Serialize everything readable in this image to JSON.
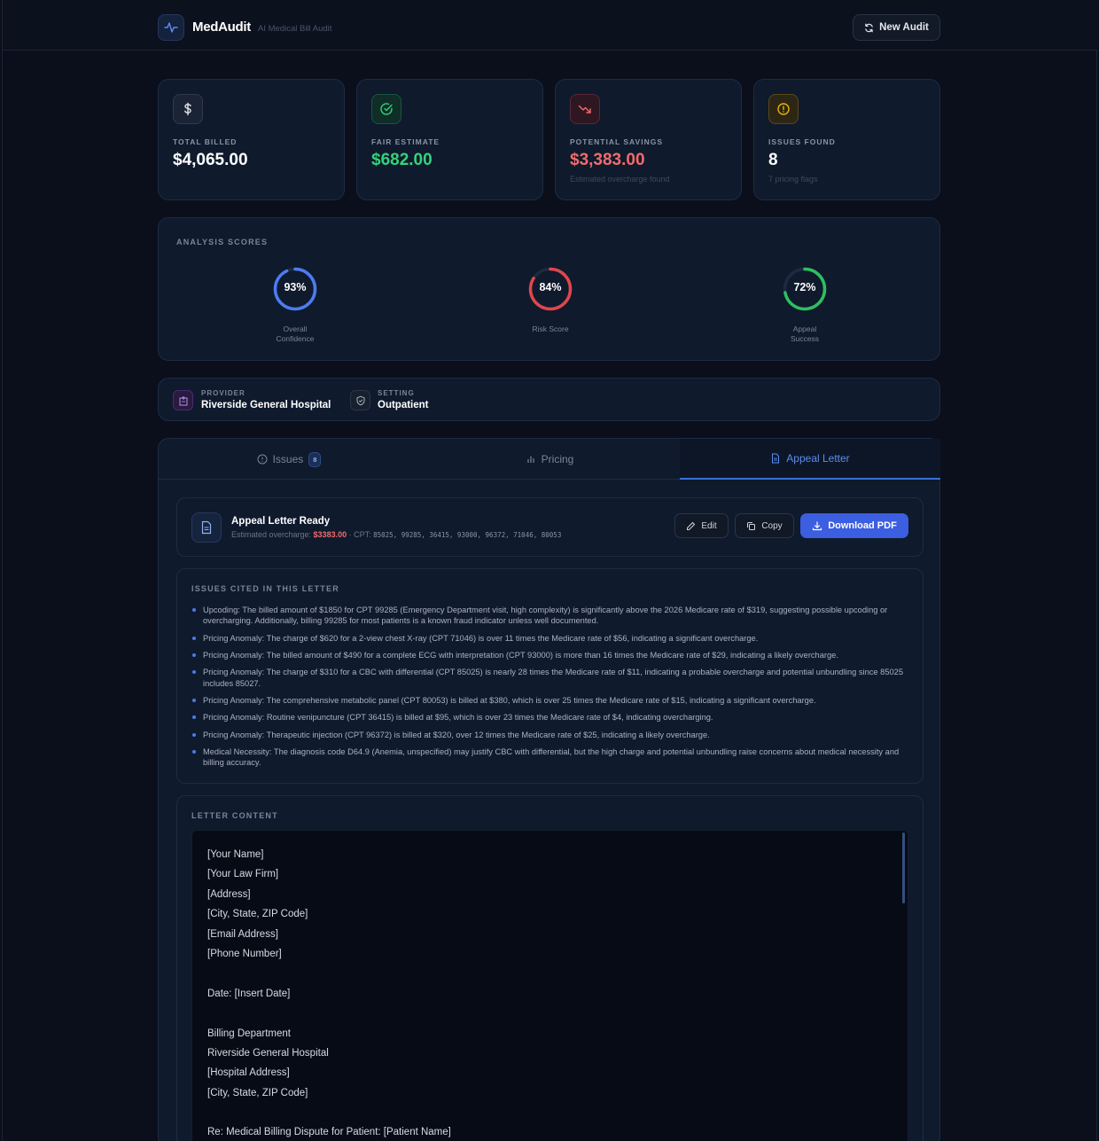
{
  "app": {
    "name": "MedAudit",
    "tagline": "AI Medical Bill Audit",
    "new_audit_label": "New Audit"
  },
  "colors": {
    "accent": "#3c5ee0",
    "green": "#34d27a",
    "red": "#f26b6b",
    "amber": "#eab308",
    "blue": "#5b8def"
  },
  "stats": [
    {
      "label": "TOTAL BILLED",
      "value": "$4,065.00",
      "sub": "",
      "icon": "dollar-icon"
    },
    {
      "label": "FAIR ESTIMATE",
      "value": "$682.00",
      "sub": "",
      "icon": "check-circle-icon"
    },
    {
      "label": "POTENTIAL SAVINGS",
      "value": "$3,383.00",
      "sub": "Estimated overcharge found",
      "icon": "trending-down-icon"
    },
    {
      "label": "ISSUES FOUND",
      "value": "8",
      "sub": "7 pricing flags",
      "icon": "alert-circle-icon"
    }
  ],
  "scores": {
    "title": "ANALYSIS SCORES",
    "items": [
      {
        "pct_label": "93%",
        "value": 93,
        "label_line1": "Overall",
        "label_line2": "Confidence",
        "color": "#4c7cf0"
      },
      {
        "pct_label": "84%",
        "value": 84,
        "label_line1": "Risk Score",
        "label_line2": "",
        "color": "#e0464c"
      },
      {
        "pct_label": "72%",
        "value": 72,
        "label_line1": "Appeal",
        "label_line2": "Success",
        "color": "#2fbf5f"
      }
    ]
  },
  "provider": {
    "provider_label": "PROVIDER",
    "provider_value": "Riverside General Hospital",
    "setting_label": "SETTING",
    "setting_value": "Outpatient"
  },
  "tabs": [
    {
      "label": "Issues",
      "badge": "8",
      "icon": "alert-circle-icon"
    },
    {
      "label": "Pricing",
      "icon": "bar-chart-icon"
    },
    {
      "label": "Appeal Letter",
      "icon": "document-icon",
      "active": true
    }
  ],
  "ready": {
    "title": "Appeal Letter Ready",
    "sub_prefix": "Estimated overcharge: ",
    "amount": "$3383.00",
    "cpt_prefix": " · CPT: ",
    "codes": "85025, 99285, 36415, 93000, 96372, 71046, 80053",
    "edit_label": "Edit",
    "copy_label": "Copy",
    "download_label": "Download PDF"
  },
  "cited": {
    "title": "ISSUES CITED IN THIS LETTER",
    "items": [
      "Upcoding: The billed amount of $1850 for CPT 99285 (Emergency Department visit, high complexity) is significantly above the 2026 Medicare rate of $319, suggesting possible upcoding or overcharging. Additionally, billing 99285 for most patients is a known fraud indicator unless well documented.",
      "Pricing Anomaly: The charge of $620 for a 2-view chest X-ray (CPT 71046) is over 11 times the Medicare rate of $56, indicating a significant overcharge.",
      "Pricing Anomaly: The billed amount of $490 for a complete ECG with interpretation (CPT 93000) is more than 16 times the Medicare rate of $29, indicating a likely overcharge.",
      "Pricing Anomaly: The charge of $310 for a CBC with differential (CPT 85025) is nearly 28 times the Medicare rate of $11, indicating a probable overcharge and potential unbundling since 85025 includes 85027.",
      "Pricing Anomaly: The comprehensive metabolic panel (CPT 80053) is billed at $380, which is over 25 times the Medicare rate of $15, indicating a significant overcharge.",
      "Pricing Anomaly: Routine venipuncture (CPT 36415) is billed at $95, which is over 23 times the Medicare rate of $4, indicating overcharging.",
      "Pricing Anomaly: Therapeutic injection (CPT 96372) is billed at $320, over 12 times the Medicare rate of $25, indicating a likely overcharge.",
      "Medical Necessity: The diagnosis code D64.9 (Anemia, unspecified) may justify CBC with differential, but the high charge and potential unbundling raise concerns about medical necessity and billing accuracy."
    ]
  },
  "letter": {
    "title": "LETTER CONTENT",
    "lines": [
      "[Your Name]",
      "[Your Law Firm]",
      "[Address]",
      "[City, State, ZIP Code]",
      "[Email Address]",
      "[Phone Number]",
      "",
      "Date: [Insert Date]",
      "",
      "Billing Department",
      "Riverside General Hospital",
      "[Hospital Address]",
      "[City, State, ZIP Code]",
      "",
      "Re: Medical Billing Dispute for Patient: [Patient Name]"
    ]
  }
}
